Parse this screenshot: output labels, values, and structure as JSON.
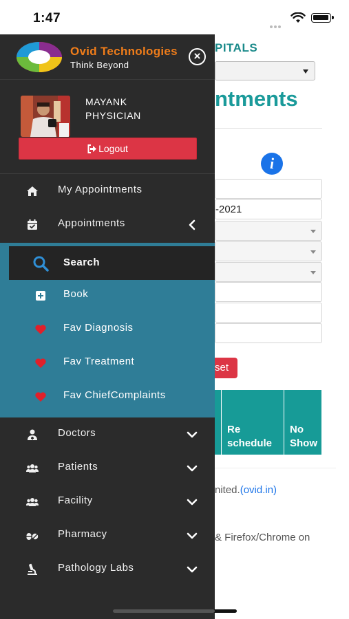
{
  "status_bar": {
    "time": "1:47"
  },
  "background_page": {
    "hospital_title_fragment": "PITALS",
    "page_heading_fragment": "ntments",
    "date_field_fragment": "-2021",
    "reset_button_fragment": "set",
    "table_headers": [
      "Re schedule",
      "No Show"
    ],
    "footer_company_fragment": "nited.",
    "footer_link": "(ovid.in)",
    "footer_browser_fragment": "& Firefox/Chrome on",
    "info_icon_glyph": "i"
  },
  "drawer": {
    "brand": {
      "name": "Ovid Technologies",
      "tagline": "Think Beyond"
    },
    "close_glyph": "×",
    "user": {
      "name": "MAYANK",
      "role": "PHYSICIAN"
    },
    "logout_label": "Logout",
    "menu": {
      "my_appointments": "My Appointments",
      "appointments": "Appointments",
      "doctors": "Doctors",
      "patients": "Patients",
      "facility": "Facility",
      "pharmacy": "Pharmacy",
      "pathology_labs": "Pathology Labs"
    },
    "appointments_submenu": {
      "search": "Search",
      "book": "Book",
      "fav_diagnosis": "Fav Diagnosis",
      "fav_treatment": "Fav Treatment",
      "fav_chief_complaints": "Fav ChiefComplaints"
    }
  },
  "colors": {
    "drawer_bg": "#2b2b2b",
    "submenu_bg": "#2f7d97",
    "active_item_bg": "#242424",
    "brand_orange": "#f07d1a",
    "logout_red": "#dc3545",
    "heart_red": "#e0202a",
    "teal_accent": "#179b97",
    "info_blue": "#1a73e8"
  }
}
